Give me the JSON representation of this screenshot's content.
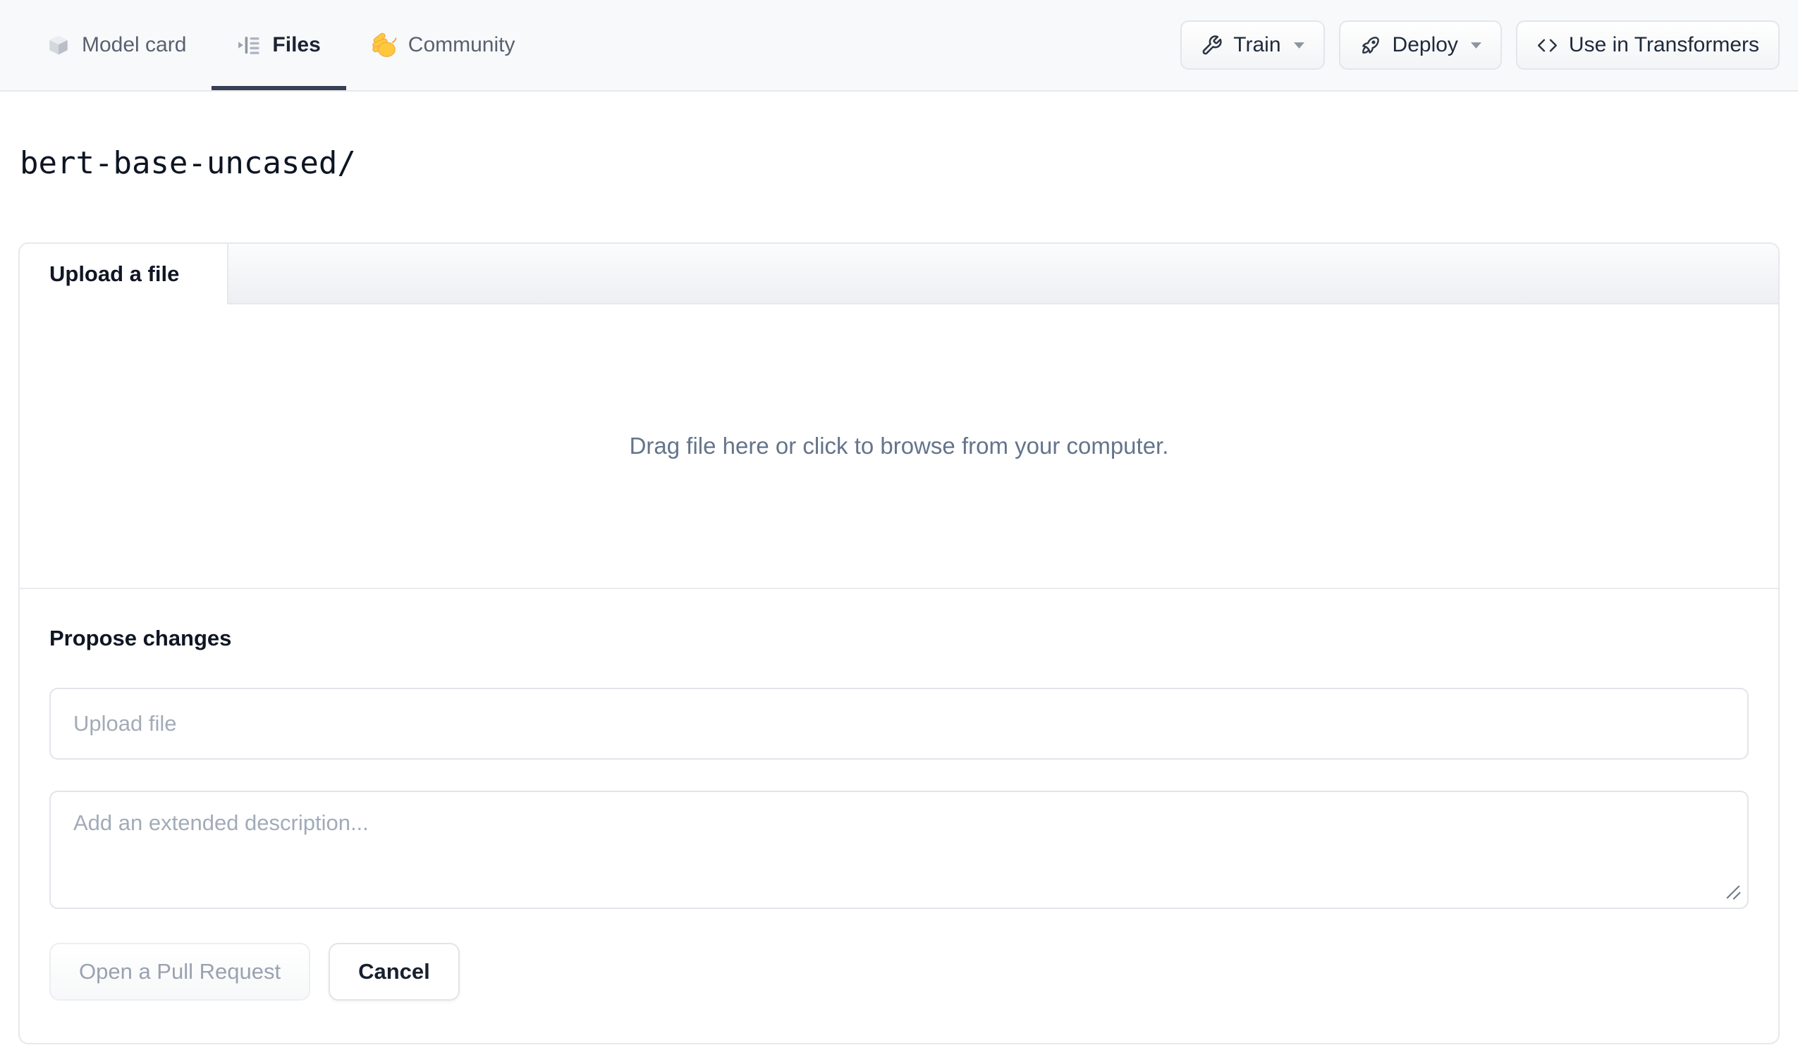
{
  "nav": {
    "tabs": [
      {
        "label": "Model card",
        "icon": "cube-icon",
        "active": false
      },
      {
        "label": "Files",
        "icon": "file-tree-icon",
        "active": true
      },
      {
        "label": "Community",
        "icon": "waving-hand-icon",
        "active": false
      }
    ],
    "actions": [
      {
        "label": "Train",
        "icon": "wrench-icon",
        "has_caret": true
      },
      {
        "label": "Deploy",
        "icon": "rocket-icon",
        "has_caret": true
      },
      {
        "label": "Use in Transformers",
        "icon": "code-icon",
        "has_caret": false
      }
    ]
  },
  "breadcrumb": {
    "repo_path": "bert-base-uncased/"
  },
  "upload_card": {
    "tab_label": "Upload a file",
    "dropzone_text": "Drag file here or click to browse from your computer.",
    "propose_heading": "Propose changes",
    "file_input_placeholder": "Upload file",
    "file_input_value": "",
    "description_placeholder": "Add an extended description...",
    "description_value": "",
    "open_pr_button": "Open a Pull Request",
    "cancel_button": "Cancel"
  },
  "colors": {
    "nav_bg": "#f8f9fb",
    "active_tab_underline": "#363f54",
    "border": "#e6e8ec",
    "muted_text": "#64748b",
    "placeholder_text": "#a2abb8",
    "disabled_button_text": "#99a2b0",
    "emoji_yellow": "#ffc83d"
  }
}
